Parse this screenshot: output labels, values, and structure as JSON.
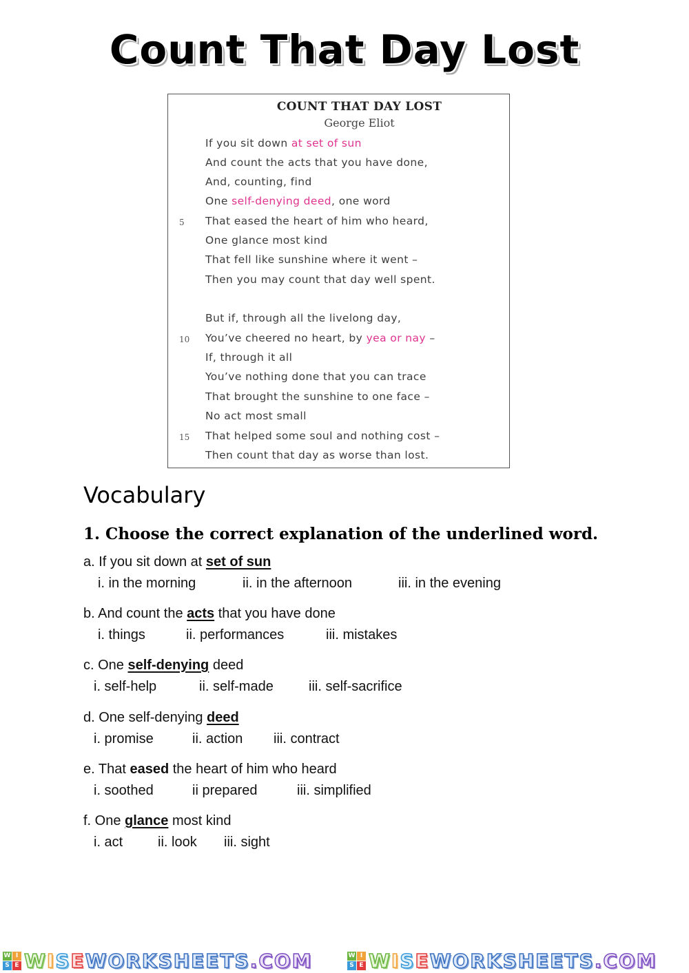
{
  "page": {
    "title": "Count That Day Lost"
  },
  "poem": {
    "title": "COUNT THAT DAY LOST",
    "author": "George Eliot",
    "highlight_color": "#e0338f",
    "lines": [
      {
        "number": "",
        "pre": "If you sit down ",
        "hl": "at set of sun",
        "post": ""
      },
      {
        "number": "",
        "pre": "And count the acts that you have done,",
        "hl": "",
        "post": ""
      },
      {
        "number": "",
        "pre": "And, counting, find",
        "hl": "",
        "post": ""
      },
      {
        "number": "",
        "pre": "One ",
        "hl": "self-denying deed",
        "post": ", one word"
      },
      {
        "number": "5",
        "pre": "That eased the heart of him who heard,",
        "hl": "",
        "post": ""
      },
      {
        "number": "",
        "pre": "One glance most kind",
        "hl": "",
        "post": ""
      },
      {
        "number": "",
        "pre": "That fell like sunshine where it went –",
        "hl": "",
        "post": ""
      },
      {
        "number": "",
        "pre": "Then you may count that day well spent.",
        "hl": "",
        "post": ""
      },
      {
        "number": "",
        "pre": "But if, through all the livelong day,",
        "hl": "",
        "post": ""
      },
      {
        "number": "10",
        "pre": "You’ve cheered no heart, by ",
        "hl": "yea or nay",
        "post": " –"
      },
      {
        "number": "",
        "pre": "If, through it all",
        "hl": "",
        "post": ""
      },
      {
        "number": "",
        "pre": "You’ve nothing done that you can trace",
        "hl": "",
        "post": ""
      },
      {
        "number": "",
        "pre": "That brought the sunshine to one face –",
        "hl": "",
        "post": ""
      },
      {
        "number": "",
        "pre": "No act most small",
        "hl": "",
        "post": ""
      },
      {
        "number": "15",
        "pre": "That helped some soul and nothing cost –",
        "hl": "",
        "post": ""
      },
      {
        "number": "",
        "pre": "Then count that day as worse than lost.",
        "hl": "",
        "post": ""
      }
    ]
  },
  "vocabulary": {
    "heading": "Vocabulary",
    "instruction": "1. Choose the correct explanation of the underlined word.",
    "questions": [
      {
        "letter": "a. ",
        "pre": "If you sit down at ",
        "keyword": "set of sun",
        "post": "",
        "underlined": true,
        "options": [
          "i.  in the morning",
          "ii. in the afternoon",
          "iii. in the evening"
        ]
      },
      {
        "letter": "b. ",
        "pre": "And count the ",
        "keyword": "acts",
        "post": " that you have done",
        "underlined": true,
        "options": [
          "i.  things",
          "ii. performances",
          "iii. mistakes"
        ]
      },
      {
        "letter": "c.  ",
        "pre": "One ",
        "keyword": "self-denying",
        "post": " deed",
        "underlined": true,
        "options": [
          "i.  self-help",
          "ii.  self-made",
          "iii. self-sacrifice"
        ]
      },
      {
        "letter": "d. ",
        "pre": "One self-denying ",
        "keyword": "deed",
        "post": "",
        "underlined": true,
        "options": [
          "i. promise",
          "ii. action",
          "iii. contract"
        ]
      },
      {
        "letter": "e. ",
        "pre": "That ",
        "keyword": "eased",
        "post": " the heart of him who heard",
        "underlined": false,
        "options": [
          "i. soothed",
          "ii prepared",
          "iii. simplified"
        ]
      },
      {
        "letter": "f.  ",
        "pre": "One ",
        "keyword": "glance",
        "post": " most kind",
        "underlined": true,
        "options": [
          "i. act",
          "ii. look",
          "iii. sight"
        ]
      }
    ]
  },
  "footer": {
    "logo_grid": [
      "W",
      "I",
      "S",
      "E"
    ],
    "logo_grid_colors": [
      "#6ab43f",
      "#f0a33a",
      "#3a9ad9",
      "#e23b3b"
    ],
    "brand_parts": [
      "W",
      "I",
      "S",
      "E",
      "WORKSHEETS",
      ".COM"
    ]
  }
}
